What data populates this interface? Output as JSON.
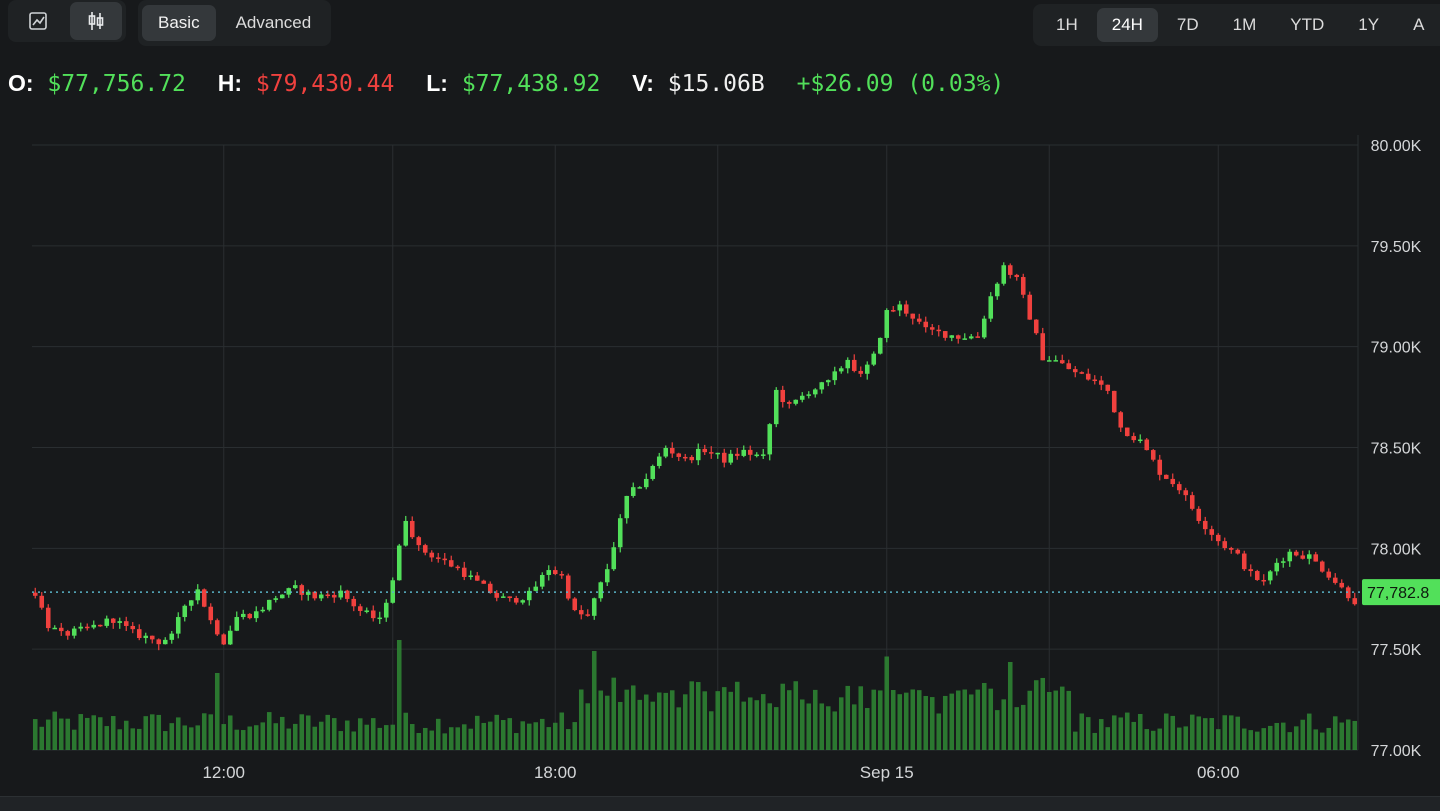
{
  "toolbar": {
    "chart_types": [
      {
        "icon": "line-chart-icon",
        "active": false
      },
      {
        "icon": "candlestick-icon",
        "active": true
      }
    ],
    "modes": [
      {
        "label": "Basic",
        "active": true
      },
      {
        "label": "Advanced",
        "active": false
      }
    ],
    "ranges": [
      {
        "label": "1H",
        "active": false
      },
      {
        "label": "24H",
        "active": true
      },
      {
        "label": "7D",
        "active": false
      },
      {
        "label": "1M",
        "active": false
      },
      {
        "label": "YTD",
        "active": false
      },
      {
        "label": "1Y",
        "active": false
      },
      {
        "label": "A",
        "active": false
      }
    ]
  },
  "ohlc": {
    "open_label": "O:",
    "open": "$77,756.72",
    "high_label": "H:",
    "high": "$79,430.44",
    "low_label": "L:",
    "low": "$77,438.92",
    "volume_label": "V:",
    "volume": "$15.06B",
    "change": "+$26.09 (0.03%)"
  },
  "colors": {
    "up": "#52e05a",
    "down": "#f0413e",
    "volume": "#2f8a34",
    "price_line": "#5ab4c8",
    "grid": "#2a2e31",
    "background": "#17191b"
  },
  "chart_data": {
    "type": "candlestick",
    "ylim": [
      77000,
      80000
    ],
    "y_ticks": [
      "80.00K",
      "79.50K",
      "79.00K",
      "78.50K",
      "78.00K",
      "77.50K",
      "77.00K"
    ],
    "x_ticks": [
      {
        "label": "12:00",
        "index": 29
      },
      {
        "label": "18:00",
        "index": 80
      },
      {
        "label": "Sep 15",
        "index": 131
      },
      {
        "label": "06:00",
        "index": 182
      }
    ],
    "current_price": 77782.8,
    "current_price_label": "77,782.8",
    "close_path": [
      [
        0,
        77780
      ],
      [
        2,
        77620
      ],
      [
        4,
        77570
      ],
      [
        8,
        77600
      ],
      [
        12,
        77650
      ],
      [
        15,
        77580
      ],
      [
        19,
        77540
      ],
      [
        21,
        77560
      ],
      [
        23,
        77720
      ],
      [
        25,
        77800
      ],
      [
        27,
        77640
      ],
      [
        29,
        77540
      ],
      [
        31,
        77660
      ],
      [
        34,
        77680
      ],
      [
        37,
        77760
      ],
      [
        40,
        77800
      ],
      [
        43,
        77760
      ],
      [
        47,
        77780
      ],
      [
        50,
        77690
      ],
      [
        53,
        77640
      ],
      [
        55,
        77850
      ],
      [
        57,
        78150
      ],
      [
        59,
        78000
      ],
      [
        62,
        77950
      ],
      [
        65,
        77900
      ],
      [
        68,
        77830
      ],
      [
        71,
        77760
      ],
      [
        73,
        77740
      ],
      [
        76,
        77770
      ],
      [
        79,
        77900
      ],
      [
        81,
        77860
      ],
      [
        83,
        77680
      ],
      [
        85,
        77660
      ],
      [
        88,
        77900
      ],
      [
        91,
        78250
      ],
      [
        94,
        78350
      ],
      [
        97,
        78500
      ],
      [
        100,
        78440
      ],
      [
        103,
        78490
      ],
      [
        106,
        78440
      ],
      [
        109,
        78480
      ],
      [
        112,
        78450
      ],
      [
        114,
        78780
      ],
      [
        116,
        78700
      ],
      [
        119,
        78780
      ],
      [
        122,
        78820
      ],
      [
        125,
        78940
      ],
      [
        127,
        78850
      ],
      [
        129,
        78950
      ],
      [
        131,
        79170
      ],
      [
        133,
        79200
      ],
      [
        135,
        79150
      ],
      [
        137,
        79080
      ],
      [
        139,
        79070
      ],
      [
        142,
        79050
      ],
      [
        145,
        79050
      ],
      [
        147,
        79250
      ],
      [
        149,
        79400
      ],
      [
        151,
        79330
      ],
      [
        153,
        79150
      ],
      [
        155,
        78950
      ],
      [
        157,
        78930
      ],
      [
        160,
        78870
      ],
      [
        163,
        78830
      ],
      [
        165,
        78780
      ],
      [
        167,
        78600
      ],
      [
        170,
        78530
      ],
      [
        173,
        78380
      ],
      [
        176,
        78300
      ],
      [
        179,
        78150
      ],
      [
        182,
        78040
      ],
      [
        185,
        77960
      ],
      [
        187,
        77870
      ],
      [
        189,
        77830
      ],
      [
        191,
        77930
      ],
      [
        193,
        77980
      ],
      [
        196,
        77960
      ],
      [
        199,
        77870
      ],
      [
        201,
        77800
      ],
      [
        203,
        77740
      ]
    ],
    "volume_pulses": [
      [
        28,
        0.7
      ],
      [
        56,
        1.0
      ],
      [
        84,
        0.55
      ],
      [
        86,
        0.9
      ],
      [
        131,
        0.85
      ],
      [
        143,
        0.55
      ],
      [
        150,
        0.8
      ]
    ]
  }
}
